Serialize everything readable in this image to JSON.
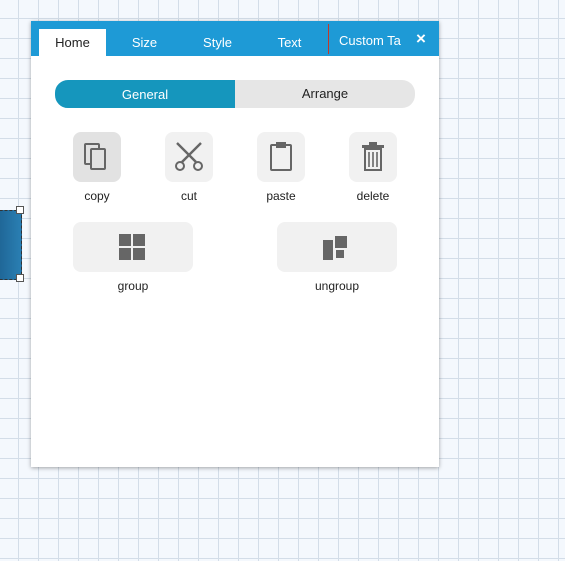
{
  "tabs": {
    "home": "Home",
    "size": "Size",
    "style": "Style",
    "text": "Text",
    "custom": "Custom Ta",
    "close": "×"
  },
  "segments": {
    "general": "General",
    "arrange": "Arrange"
  },
  "tools": {
    "copy": "copy",
    "cut": "cut",
    "paste": "paste",
    "delete": "delete",
    "group": "group",
    "ungroup": "ungroup"
  },
  "colors": {
    "accent": "#1e9ad6",
    "segment_active": "#1596bd",
    "icon": "#666666"
  },
  "icons": {
    "copy": "copy-icon",
    "cut": "scissors-icon",
    "paste": "clipboard-icon",
    "delete": "trash-icon",
    "group": "group-icon",
    "ungroup": "ungroup-icon",
    "close": "close-icon"
  }
}
